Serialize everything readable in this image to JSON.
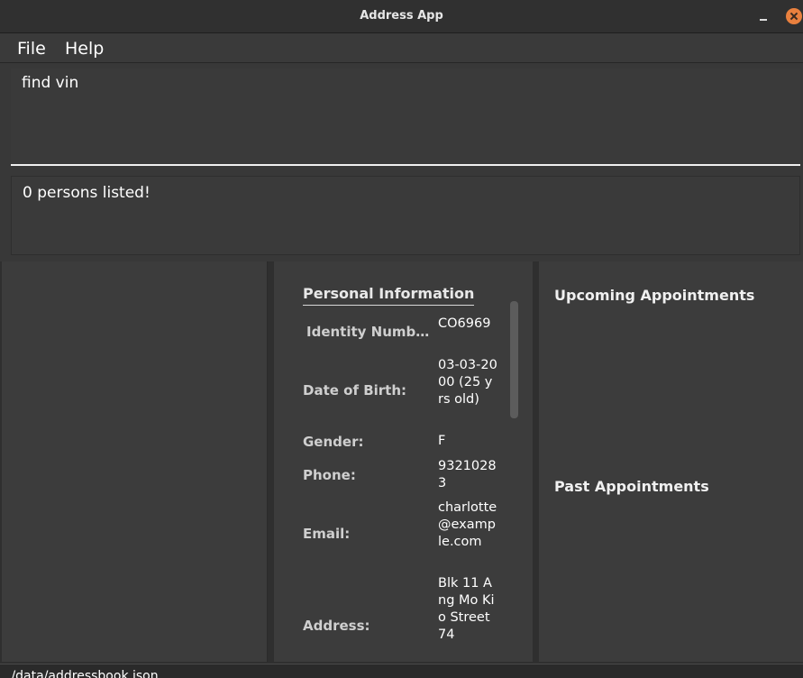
{
  "window": {
    "title": "Address App"
  },
  "menu": {
    "items": [
      {
        "label": "File"
      },
      {
        "label": "Help"
      }
    ]
  },
  "command": {
    "value": "find vin"
  },
  "result": {
    "message": "0 persons listed!"
  },
  "personal_info": {
    "heading": "Personal Information",
    "rows": [
      {
        "label": "Identity Numb...",
        "value": "CO6969"
      },
      {
        "label": "Date of Birth:",
        "value": "03-03-2000 (25 yrs old)"
      },
      {
        "label": "Gender:",
        "value": "F"
      },
      {
        "label": "Phone:",
        "value": "93210283"
      },
      {
        "label": "Email:",
        "value": "charlotte@example.com"
      },
      {
        "label": "Address:",
        "value": "Blk 11 Ang Mo Kio Street 74"
      }
    ]
  },
  "appointments": {
    "upcoming_heading": "Upcoming Appointments",
    "past_heading": "Past Appointments"
  },
  "status": {
    "path": "./data/addressbook.json"
  },
  "colors": {
    "close_button": "#e9803e",
    "background": "#3c3c3c"
  },
  "icons": {
    "minimize": "minimize-icon",
    "close": "close-icon"
  }
}
